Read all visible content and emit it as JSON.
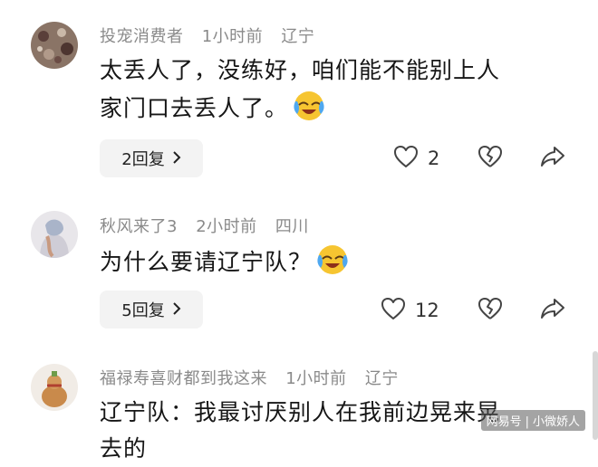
{
  "comments": [
    {
      "username": "投宠消费者",
      "time": "1小时前",
      "location": "辽宁",
      "text_line1": "太丢人了，没练好，咱们能不能别上人",
      "text_line2": "家门口去丢人了。",
      "emoji": "laughing-crying-emoji",
      "reply_label": "2回复",
      "like_count": "2"
    },
    {
      "username": "秋风来了3",
      "time": "2小时前",
      "location": "四川",
      "text_line1": "为什么要请辽宁队？",
      "emoji": "laughing-crying-emoji",
      "reply_label": "5回复",
      "like_count": "12"
    },
    {
      "username": "福禄寿喜财都到我这来",
      "time": "1小时前",
      "location": "辽宁",
      "text_line1": "辽宁队：我最讨厌别人在我前边晃来晃",
      "text_line2": "去的"
    }
  ],
  "watermark": {
    "source": "网易号",
    "author": "小微娇人"
  },
  "icons": [
    "heart-icon",
    "broken-heart-icon",
    "share-icon",
    "chevron-right-icon"
  ]
}
